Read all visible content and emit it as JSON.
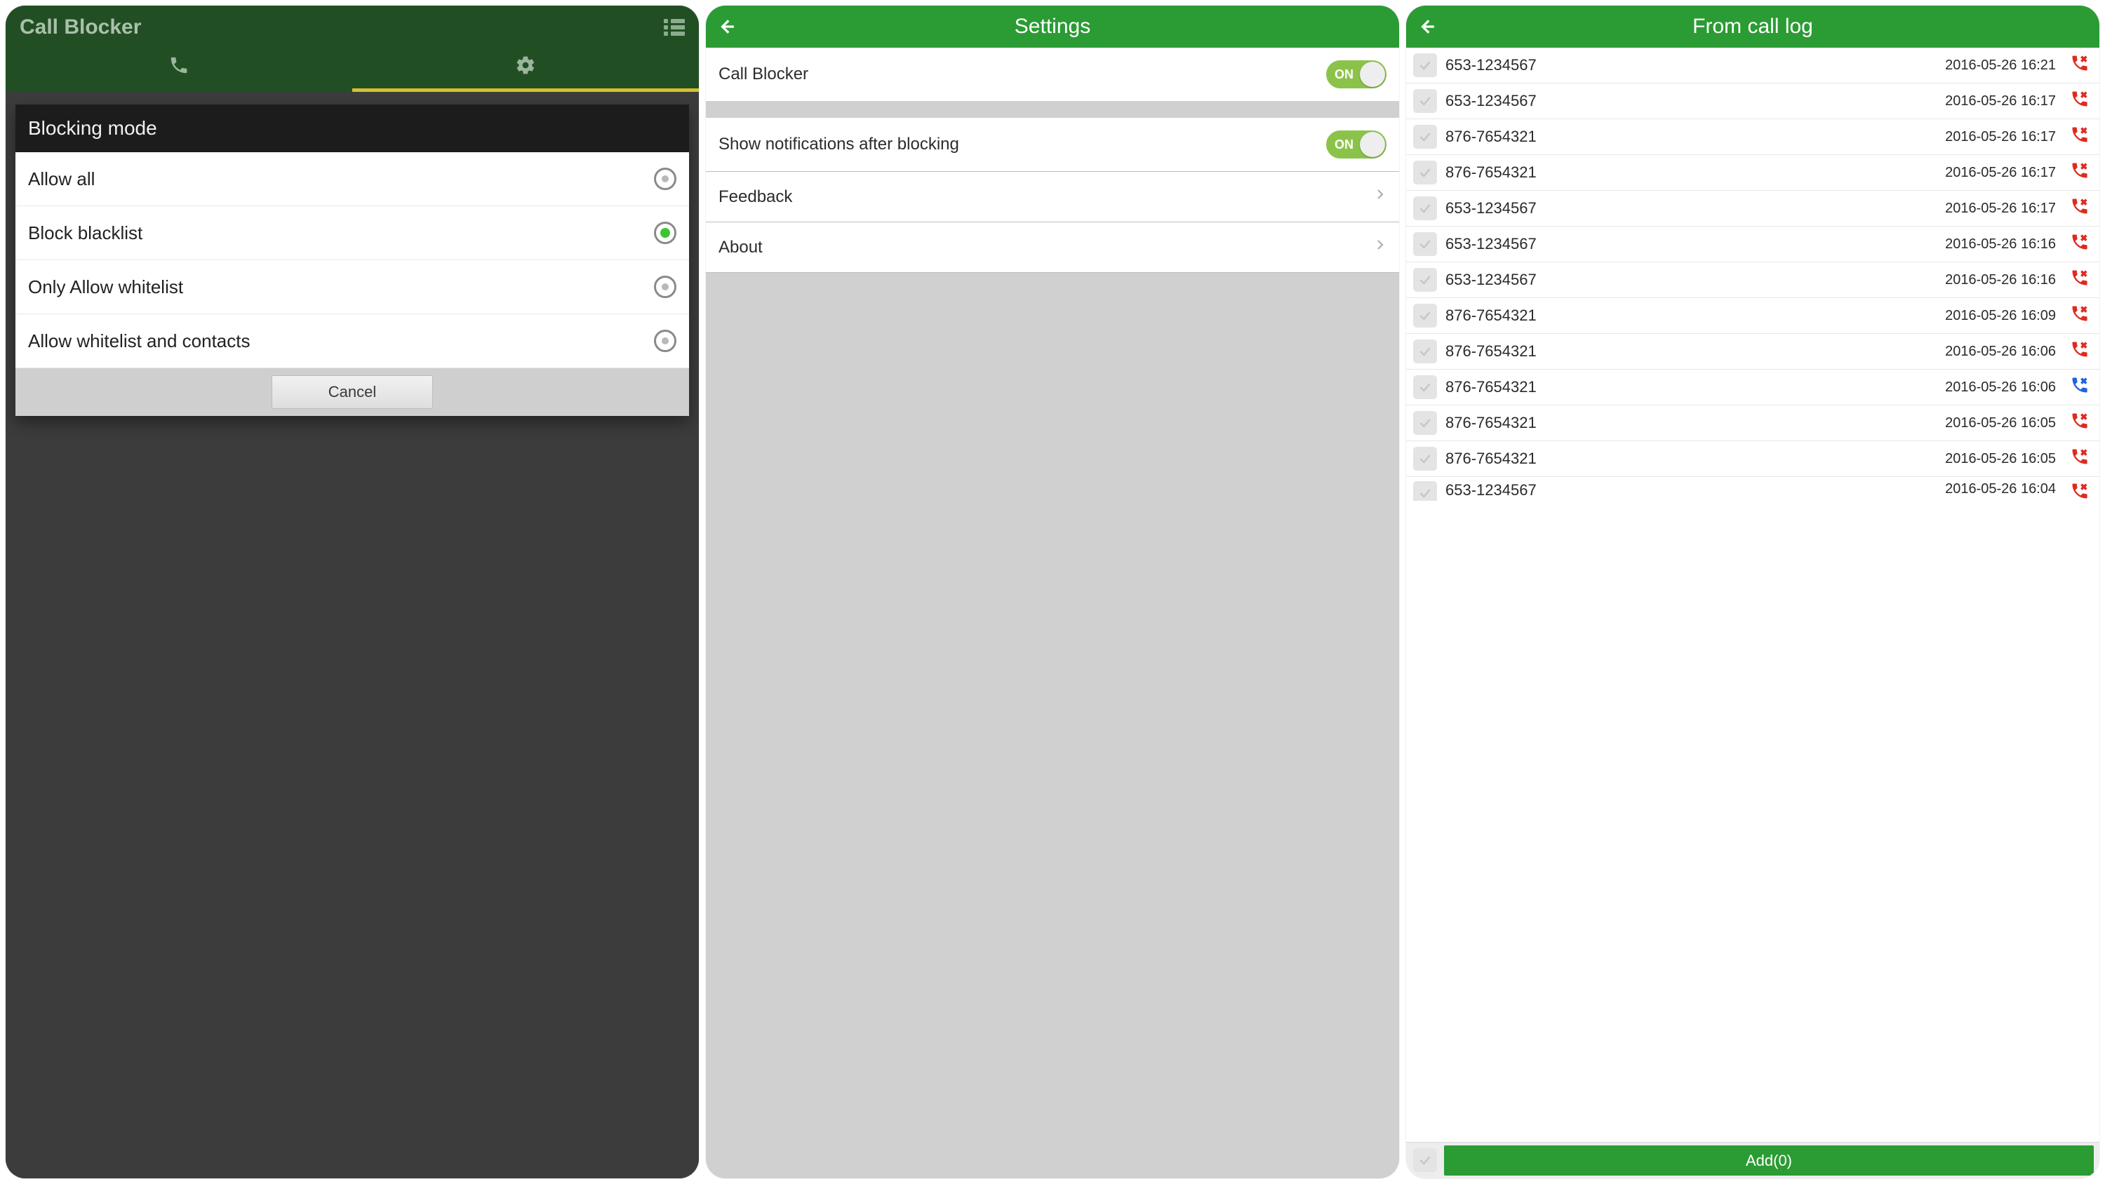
{
  "colors": {
    "brand_green": "#2b9b34",
    "header_dark_green": "#224e23",
    "toggle_green": "#8bc34a",
    "call_red": "#e02a1e",
    "call_blue": "#1c63e0"
  },
  "screen1": {
    "app_title": "Call Blocker",
    "dialog": {
      "title": "Blocking mode",
      "options": [
        {
          "label": "Allow all",
          "selected": false
        },
        {
          "label": "Block blacklist",
          "selected": true
        },
        {
          "label": "Only Allow whitelist",
          "selected": false
        },
        {
          "label": "Allow whitelist and contacts",
          "selected": false
        }
      ],
      "cancel": "Cancel"
    }
  },
  "screen2": {
    "title": "Settings",
    "rows": {
      "call_blocker_label": "Call Blocker",
      "call_blocker_on": "ON",
      "notifications_label": "Show notifications after blocking",
      "notifications_on": "ON",
      "feedback": "Feedback",
      "about": "About"
    }
  },
  "screen3": {
    "title": "From call log",
    "entries": [
      {
        "number": "653-1234567",
        "time": "2016-05-26 16:21",
        "type": "missed"
      },
      {
        "number": "653-1234567",
        "time": "2016-05-26 16:17",
        "type": "missed"
      },
      {
        "number": "876-7654321",
        "time": "2016-05-26 16:17",
        "type": "missed"
      },
      {
        "number": "876-7654321",
        "time": "2016-05-26 16:17",
        "type": "missed"
      },
      {
        "number": "653-1234567",
        "time": "2016-05-26 16:17",
        "type": "missed"
      },
      {
        "number": "653-1234567",
        "time": "2016-05-26 16:16",
        "type": "missed"
      },
      {
        "number": "653-1234567",
        "time": "2016-05-26 16:16",
        "type": "missed"
      },
      {
        "number": "876-7654321",
        "time": "2016-05-26 16:09",
        "type": "missed"
      },
      {
        "number": "876-7654321",
        "time": "2016-05-26 16:06",
        "type": "missed"
      },
      {
        "number": "876-7654321",
        "time": "2016-05-26 16:06",
        "type": "incoming"
      },
      {
        "number": "876-7654321",
        "time": "2016-05-26 16:05",
        "type": "missed"
      },
      {
        "number": "876-7654321",
        "time": "2016-05-26 16:05",
        "type": "missed"
      },
      {
        "number": "653-1234567",
        "time": "2016-05-26 16:04",
        "type": "missed"
      }
    ],
    "add_button": "Add(0)"
  }
}
